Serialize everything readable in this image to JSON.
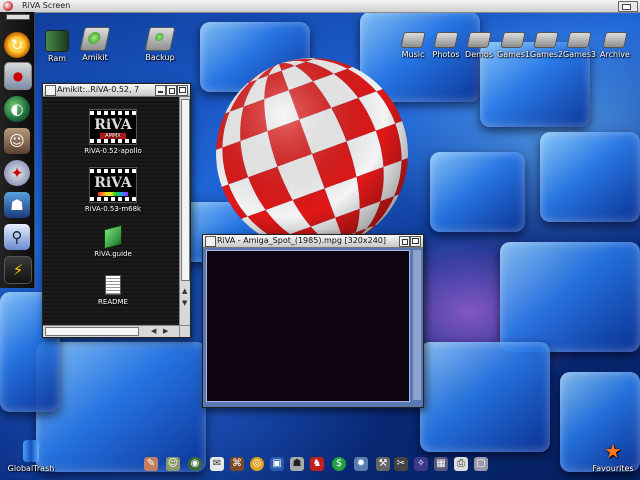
{
  "screen": {
    "title": "RiVA Screen"
  },
  "desktop_icons": {
    "ram": "Ram",
    "amikit": "Amikit",
    "backup": "Backup",
    "music": "Music",
    "photos": "Photos",
    "demos": "Demos",
    "games1": "Games1",
    "games2": "Games2",
    "games3": "Games3",
    "archive": "Archive",
    "global_trash": "GlobalTrash",
    "favourites": "Favourites"
  },
  "drawer_window": {
    "title": "Amikit:..RiVA-0.52, 7",
    "items": {
      "apollo": "RiVA-0.52-apollo",
      "m68k": "RiVA-0.53-m68k",
      "guide": "RiVA.guide",
      "readme": "README"
    },
    "logo_text": "RiVA",
    "logo_badge": "AMMX"
  },
  "player_window": {
    "title": "RiVA - Amiga_Spot_(1985).mpg  [320x240]"
  },
  "colors": {
    "ball_red": "#e01818",
    "ball_white": "#f4f4f4",
    "desktop_blue": "#1f66d8",
    "player_frame": "#5a78b4"
  }
}
